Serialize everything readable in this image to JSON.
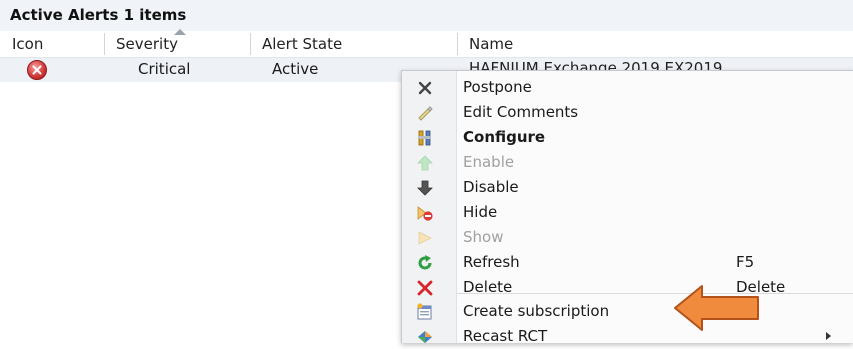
{
  "panel": {
    "title": "Active Alerts 1 items"
  },
  "columns": {
    "icon": "Icon",
    "severity": "Severity",
    "alert_state": "Alert State",
    "name": "Name"
  },
  "alert": {
    "icon": "critical-icon",
    "severity": "Critical",
    "alert_state": "Active",
    "name": "HAFNIUM Exchange 2019 EX2019"
  },
  "context_menu": {
    "items": [
      {
        "label": "Postpone",
        "icon": "close-x-icon",
        "enabled": true
      },
      {
        "label": "Edit Comments",
        "icon": "pencil-icon",
        "enabled": true
      },
      {
        "label": "Configure",
        "icon": "tools-icon",
        "enabled": true,
        "bold": true
      },
      {
        "label": "Enable",
        "icon": "arrow-up-icon",
        "enabled": false
      },
      {
        "label": "Disable",
        "icon": "arrow-down-icon",
        "enabled": true
      },
      {
        "label": "Hide",
        "icon": "hide-icon",
        "enabled": true
      },
      {
        "label": "Show",
        "icon": "show-icon",
        "enabled": false
      },
      {
        "label": "Refresh",
        "icon": "refresh-icon",
        "enabled": true,
        "shortcut": "F5"
      },
      {
        "label": "Delete",
        "icon": "delete-icon",
        "enabled": true,
        "shortcut": "Delete"
      },
      {
        "label": "Create subscription",
        "icon": "subscription-icon",
        "enabled": true
      },
      {
        "label": "Recast RCT",
        "icon": "recast-icon",
        "enabled": true,
        "has_submenu": true
      }
    ]
  },
  "colors": {
    "header_bg": "#f0f3f8",
    "row_bg": "#eef1f6",
    "critical": "#d43a3a",
    "callout_arrow": "#f08a3c"
  }
}
